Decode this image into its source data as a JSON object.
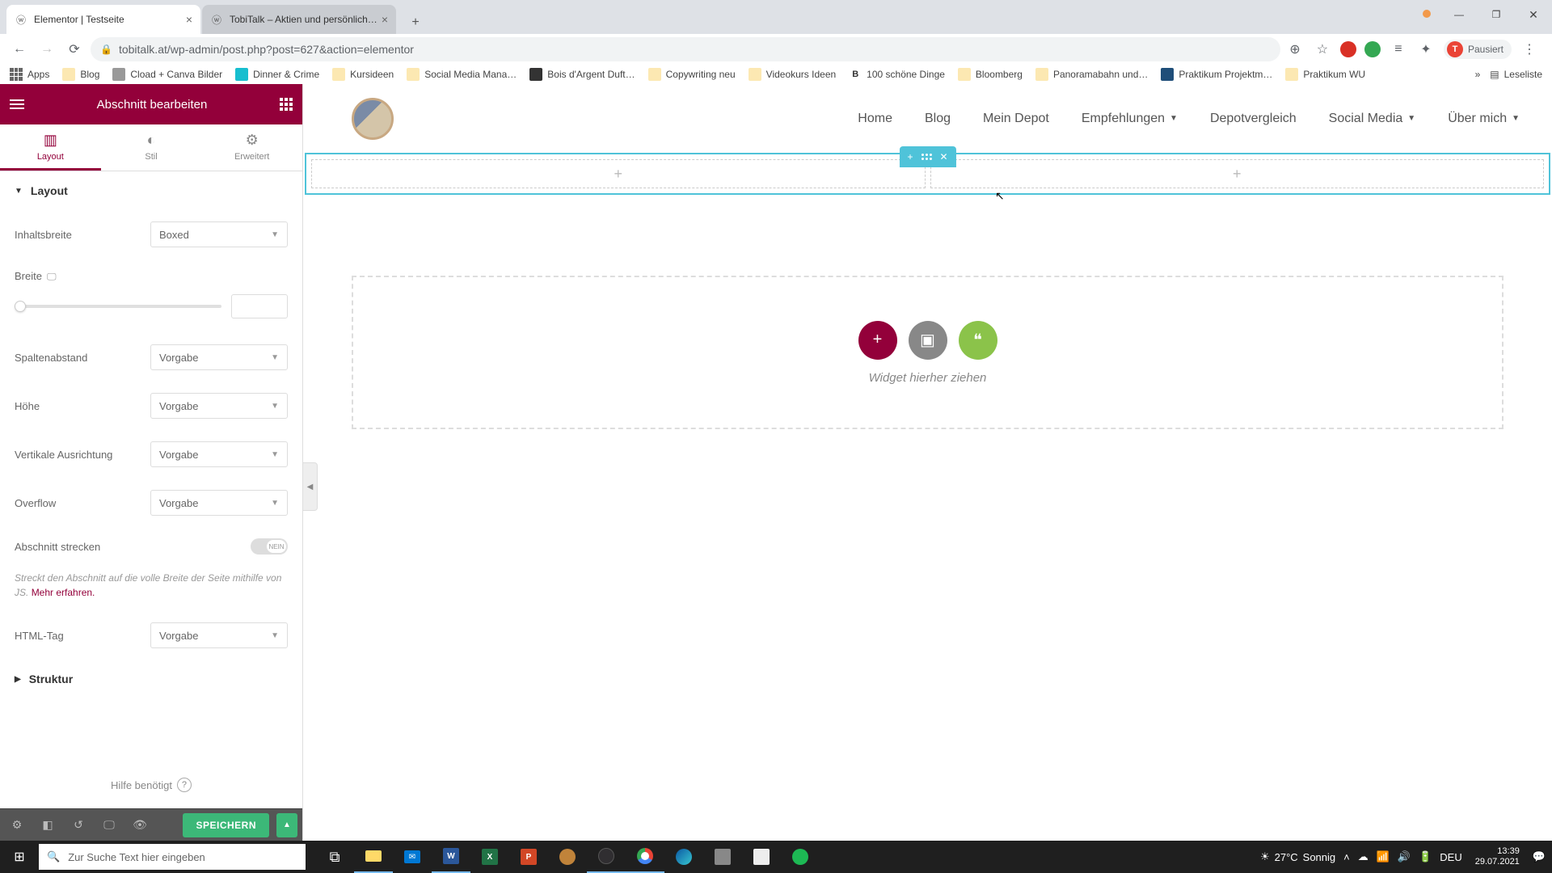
{
  "browser": {
    "tabs": [
      {
        "title": "Elementor | Testseite",
        "active": true
      },
      {
        "title": "TobiTalk – Aktien und persönlich…",
        "active": false
      }
    ],
    "url": "tobitalk.at/wp-admin/post.php?post=627&action=elementor",
    "profile_status": "Pausiert",
    "profile_initial": "T",
    "bookmarks": {
      "apps": "Apps",
      "items": [
        "Blog",
        "Cload + Canva Bilder",
        "Dinner & Crime",
        "Kursideen",
        "Social Media Mana…",
        "Bois d'Argent Duft…",
        "Copywriting neu",
        "Videokurs Ideen",
        "100 schöne Dinge",
        "Bloomberg",
        "Panoramabahn und…",
        "Praktikum Projektm…",
        "Praktikum WU"
      ],
      "overflow": "»",
      "reading_list": "Leseliste"
    }
  },
  "elementor": {
    "header_title": "Abschnitt bearbeiten",
    "tabs": {
      "layout": "Layout",
      "style": "Stil",
      "advanced": "Erweitert"
    },
    "sections": {
      "layout": "Layout",
      "struktur": "Struktur"
    },
    "controls": {
      "content_width": {
        "label": "Inhaltsbreite",
        "value": "Boxed"
      },
      "width": {
        "label": "Breite"
      },
      "column_gap": {
        "label": "Spaltenabstand",
        "value": "Vorgabe"
      },
      "height": {
        "label": "Höhe",
        "value": "Vorgabe"
      },
      "vertical_align": {
        "label": "Vertikale Ausrichtung",
        "value": "Vorgabe"
      },
      "overflow": {
        "label": "Overflow",
        "value": "Vorgabe"
      },
      "stretch": {
        "label": "Abschnitt strecken",
        "toggle_text": "NEIN"
      },
      "stretch_desc": "Streckt den Abschnitt auf die volle Breite der Seite mithilfe von JS.",
      "stretch_link": "Mehr erfahren.",
      "html_tag": {
        "label": "HTML-Tag",
        "value": "Vorgabe"
      }
    },
    "help": "Hilfe benötigt",
    "save": "SPEICHERN"
  },
  "preview": {
    "nav": [
      "Home",
      "Blog",
      "Mein Depot",
      "Empfehlungen",
      "Depotvergleich",
      "Social Media",
      "Über mich"
    ],
    "nav_dropdown": [
      false,
      false,
      false,
      true,
      false,
      true,
      true
    ],
    "dropzone_text": "Widget hierher ziehen"
  },
  "taskbar": {
    "search_placeholder": "Zur Suche Text hier eingeben",
    "weather_temp": "27°C",
    "weather_desc": "Sonnig",
    "lang": "DEU",
    "time": "13:39",
    "date": "29.07.2021"
  }
}
